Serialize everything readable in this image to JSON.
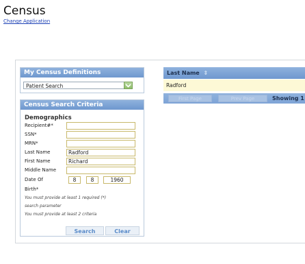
{
  "page": {
    "title": "Census",
    "change_link": "Change Application"
  },
  "definitions": {
    "header": "My Census Definitions",
    "selected": "Patient Search"
  },
  "criteria": {
    "header": "Census Search Criteria",
    "section": "Demographics",
    "fields": [
      {
        "label": "Recipient#*",
        "value": ""
      },
      {
        "label": "SSN*",
        "value": ""
      },
      {
        "label": "MRN*",
        "value": ""
      },
      {
        "label": "Last Name",
        "value": "Radford"
      },
      {
        "label": "First Name",
        "value": "Richard"
      },
      {
        "label": "Middle Name",
        "value": ""
      }
    ],
    "dob": {
      "label_line1": "Date Of",
      "label_line2": "Birth*",
      "month": "8",
      "day": "8",
      "year": "1960"
    },
    "notes": [
      "You must provide at least 1 required (*)",
      "search parameter",
      "You must provide at least 2 criteria"
    ],
    "search_label": "Search",
    "clear_label": "Clear"
  },
  "results": {
    "column": "Last Name",
    "sort_icon": "sort-icon",
    "rows": [
      "Radford"
    ],
    "first_page": "First Page",
    "prev_page": "Prev Page",
    "showing": "Showing 1"
  },
  "colors": {
    "accent": "#7ea4d6",
    "row_highlight": "#fdf9d6",
    "link": "#1a3fb5"
  }
}
